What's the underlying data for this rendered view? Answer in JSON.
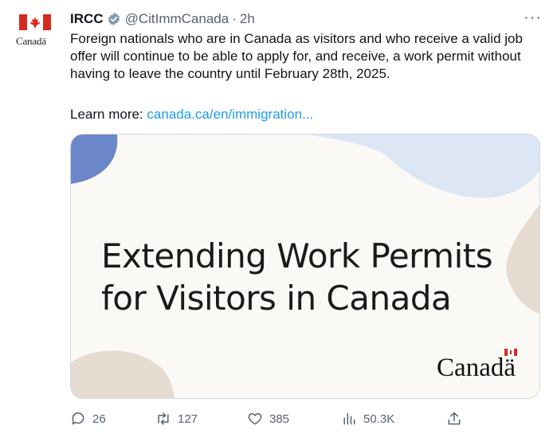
{
  "author": {
    "name": "IRCC",
    "handle": "@CitImmCanada",
    "separator": "·",
    "time": "2h",
    "avatar_wordmark": "Canadä"
  },
  "more_label": "···",
  "tweet": {
    "text": "Foreign nationals who are in Canada as visitors and who receive a valid job offer will continue to be able to apply for, and receive, a work permit without having to leave the country until February 28th, 2025.",
    "learn_more_label": "Learn more:",
    "link_text": "canada.ca/en/immigration..."
  },
  "card": {
    "title_line1": "Extending Work Permits",
    "title_line2": "for Visitors in Canada",
    "logo_text": "Canadä"
  },
  "actions": {
    "replies": "26",
    "retweets": "127",
    "likes": "385",
    "views": "50.3K"
  },
  "colors": {
    "link": "#1d9bf0",
    "muted": "#536471",
    "flag_red": "#d52b1e",
    "card_blue": "#6b86c9",
    "card_light_blue": "#dce6f5",
    "card_beige": "#e6dbd1"
  }
}
